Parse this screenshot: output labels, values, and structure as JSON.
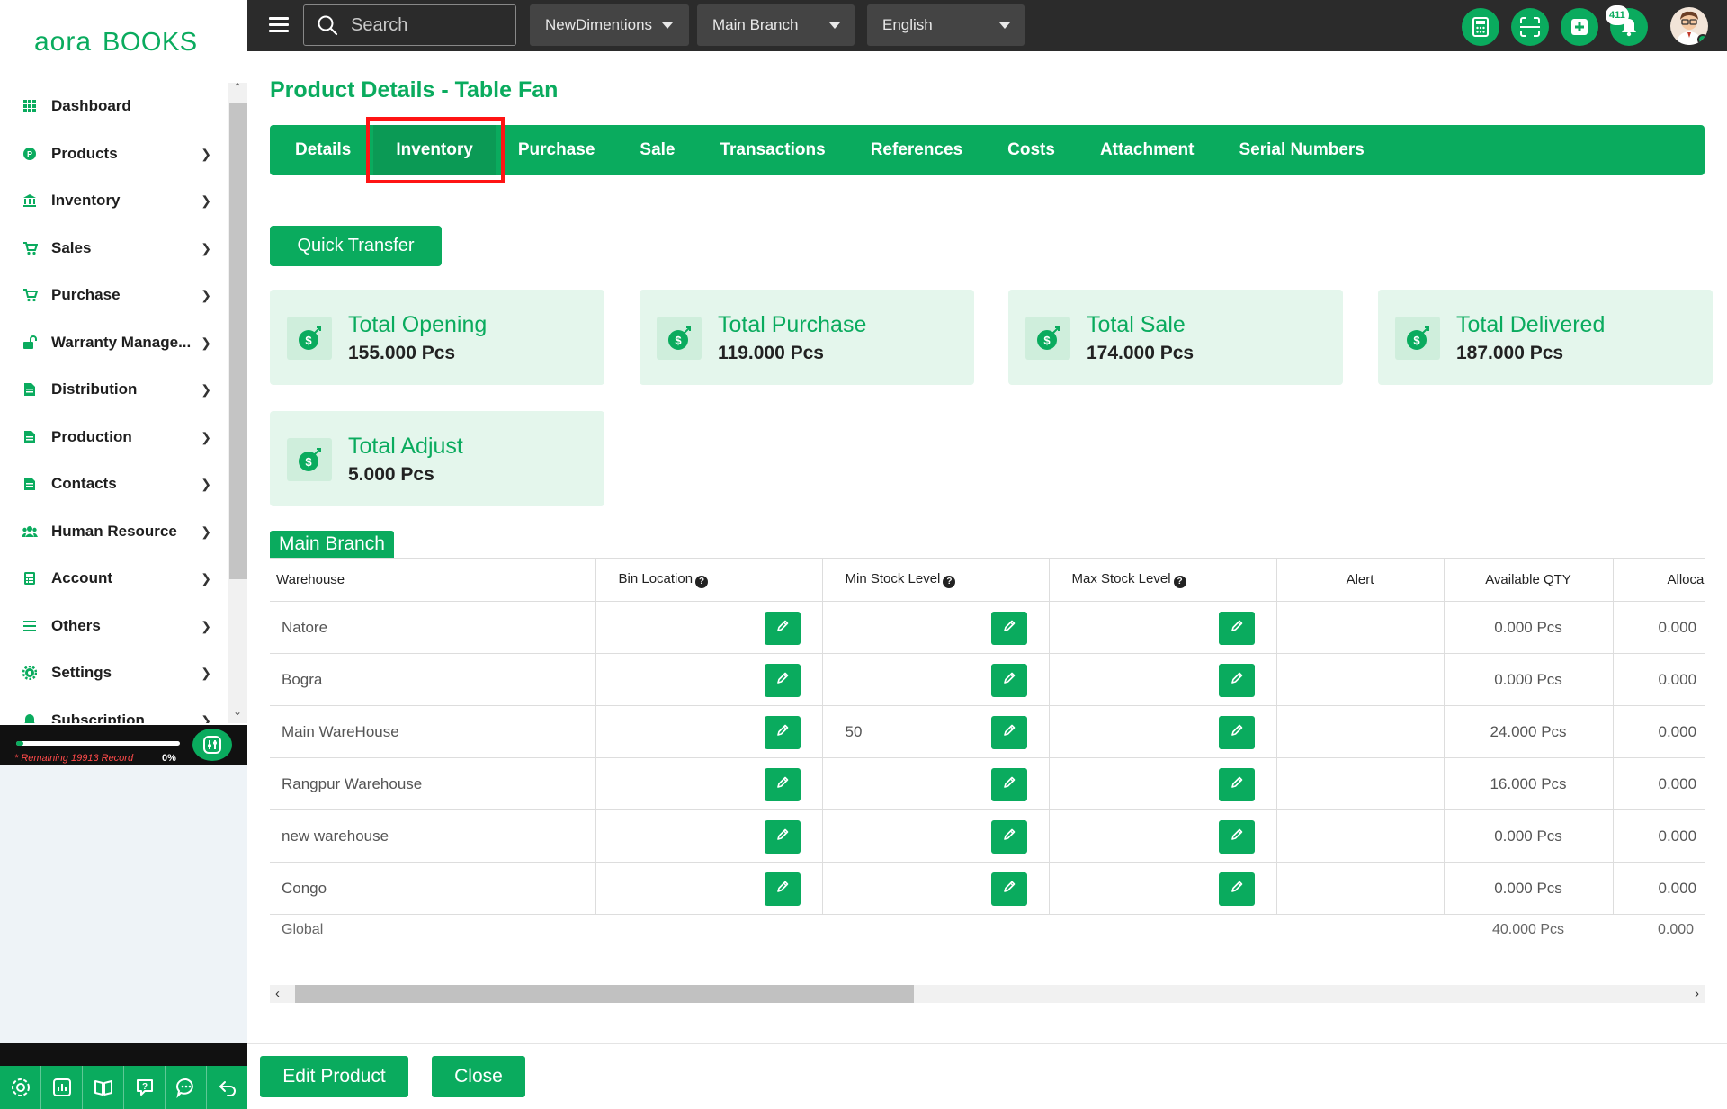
{
  "app": {
    "logo": "aoraBOOKS"
  },
  "sidebar": {
    "items": [
      {
        "label": "Dashboard",
        "icon": "grid-icon",
        "chevron": false
      },
      {
        "label": "Products",
        "icon": "product-icon",
        "chevron": true
      },
      {
        "label": "Inventory",
        "icon": "bank-icon",
        "chevron": true
      },
      {
        "label": "Sales",
        "icon": "cart-icon",
        "chevron": true
      },
      {
        "label": "Purchase",
        "icon": "cart-icon",
        "chevron": true
      },
      {
        "label": "Warranty Manage...",
        "icon": "unlock-icon",
        "chevron": true
      },
      {
        "label": "Distribution",
        "icon": "document-icon",
        "chevron": true
      },
      {
        "label": "Production",
        "icon": "document-icon",
        "chevron": true
      },
      {
        "label": "Contacts",
        "icon": "document-icon",
        "chevron": true
      },
      {
        "label": "Human Resource",
        "icon": "users-icon",
        "chevron": true
      },
      {
        "label": "Account",
        "icon": "calculator-icon",
        "chevron": true
      },
      {
        "label": "Others",
        "icon": "list-icon",
        "chevron": true
      },
      {
        "label": "Settings",
        "icon": "gear-icon",
        "chevron": true
      },
      {
        "label": "Subscription",
        "icon": "bell-icon",
        "chevron": true
      }
    ],
    "record": {
      "text": "* Remaining 19913 Record",
      "percent": "0%",
      "progress_fraction": 0.0
    }
  },
  "topbar": {
    "search_placeholder": "Search",
    "company": "NewDimentions",
    "branch": "Main Branch",
    "language": "English",
    "notification_count": "411"
  },
  "page": {
    "title": "Product Details - Table Fan",
    "tabs": [
      "Details",
      "Inventory",
      "Purchase",
      "Sale",
      "Transactions",
      "References",
      "Costs",
      "Attachment",
      "Serial Numbers"
    ],
    "active_tab": "Inventory",
    "quick_transfer": "Quick Transfer"
  },
  "cards": [
    {
      "title": "Total Opening",
      "value": "155.000 Pcs"
    },
    {
      "title": "Total Purchase",
      "value": "119.000 Pcs"
    },
    {
      "title": "Total Sale",
      "value": "174.000 Pcs"
    },
    {
      "title": "Total Delivered",
      "value": "187.000 Pcs"
    },
    {
      "title": "Total Adjust",
      "value": "5.000 Pcs"
    }
  ],
  "branch": {
    "name": "Main Branch",
    "columns": [
      "Warehouse",
      "Bin Location",
      "Min Stock Level",
      "Max Stock Level",
      "Alert",
      "Available QTY",
      "Alloca"
    ],
    "rows": [
      {
        "warehouse": "Natore",
        "bin": "",
        "min": "",
        "max": "",
        "alert": "",
        "available": "0.000 Pcs",
        "allocated": "0.000"
      },
      {
        "warehouse": "Bogra",
        "bin": "",
        "min": "",
        "max": "",
        "alert": "",
        "available": "0.000 Pcs",
        "allocated": "0.000"
      },
      {
        "warehouse": "Main WareHouse",
        "bin": "",
        "min": "50",
        "max": "",
        "alert": "",
        "available": "24.000 Pcs",
        "allocated": "0.000"
      },
      {
        "warehouse": "Rangpur Warehouse",
        "bin": "",
        "min": "",
        "max": "",
        "alert": "",
        "available": "16.000 Pcs",
        "allocated": "0.000"
      },
      {
        "warehouse": "new warehouse",
        "bin": "",
        "min": "",
        "max": "",
        "alert": "",
        "available": "0.000 Pcs",
        "allocated": "0.000"
      },
      {
        "warehouse": "Congo",
        "bin": "",
        "min": "",
        "max": "",
        "alert": "",
        "available": "0.000 Pcs",
        "allocated": "0.000"
      }
    ],
    "global": {
      "label": "Global",
      "available": "40.000 Pcs",
      "allocated": "0.000"
    }
  },
  "footer": {
    "edit_product": "Edit Product",
    "close": "Close"
  },
  "colors": {
    "accent": "#0aab5e",
    "topbar": "#2b2b2b",
    "card_bg": "#e4f6ec",
    "highlight": "#ff1414"
  }
}
